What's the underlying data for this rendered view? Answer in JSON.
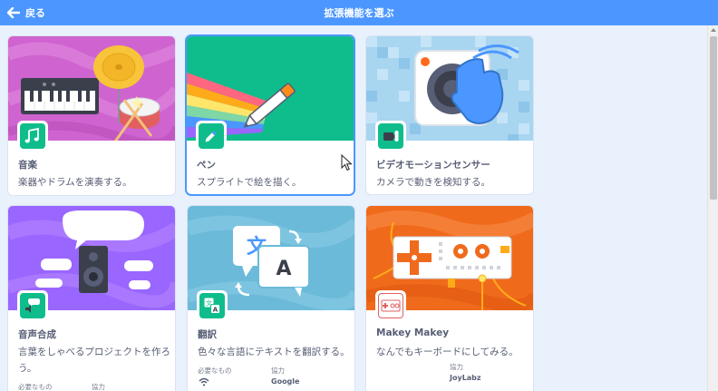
{
  "header": {
    "back_label": "戻る",
    "title": "拡張機能を選ぶ"
  },
  "colors": {
    "header": "#4c97ff",
    "background": "#e9f1fc",
    "badge": "#0fbd8c",
    "text": "#575e75"
  },
  "extensions": [
    {
      "title": "音楽",
      "description": "楽器やドラムを演奏する。",
      "icon": "music-notes-icon",
      "banner_color": "#cf63cf"
    },
    {
      "title": "ペン",
      "description": "スプライトで絵を描く。",
      "icon": "pen-icon",
      "banner_color": "#0fbd8c",
      "selected": true
    },
    {
      "title": "ビデオモーションセンサー",
      "description": "カメラで動きを検知する。",
      "icon": "video-camera-icon",
      "banner_color": "#a8d5f0"
    },
    {
      "title": "音声合成",
      "description": "言葉をしゃべるプロジェクトを作ろう。",
      "icon": "speech-icon",
      "banner_color": "#9966ff",
      "requires_label": "必要なもの",
      "collab_label": "協力"
    },
    {
      "title": "翻訳",
      "description": "色々な言語にテキストを翻訳する。",
      "icon": "translate-icon",
      "banner_color": "#6bbad9",
      "requires_label": "必要なもの",
      "collab_label": "協力",
      "requires": "wifi-icon",
      "collaborator": "Google"
    },
    {
      "title": "Makey Makey",
      "description": "なんでもキーボードにしてみる。",
      "icon": "makey-makey-icon",
      "banner_color": "#f06a1c",
      "collab_label": "協力",
      "collaborator": "JoyLabz"
    }
  ]
}
